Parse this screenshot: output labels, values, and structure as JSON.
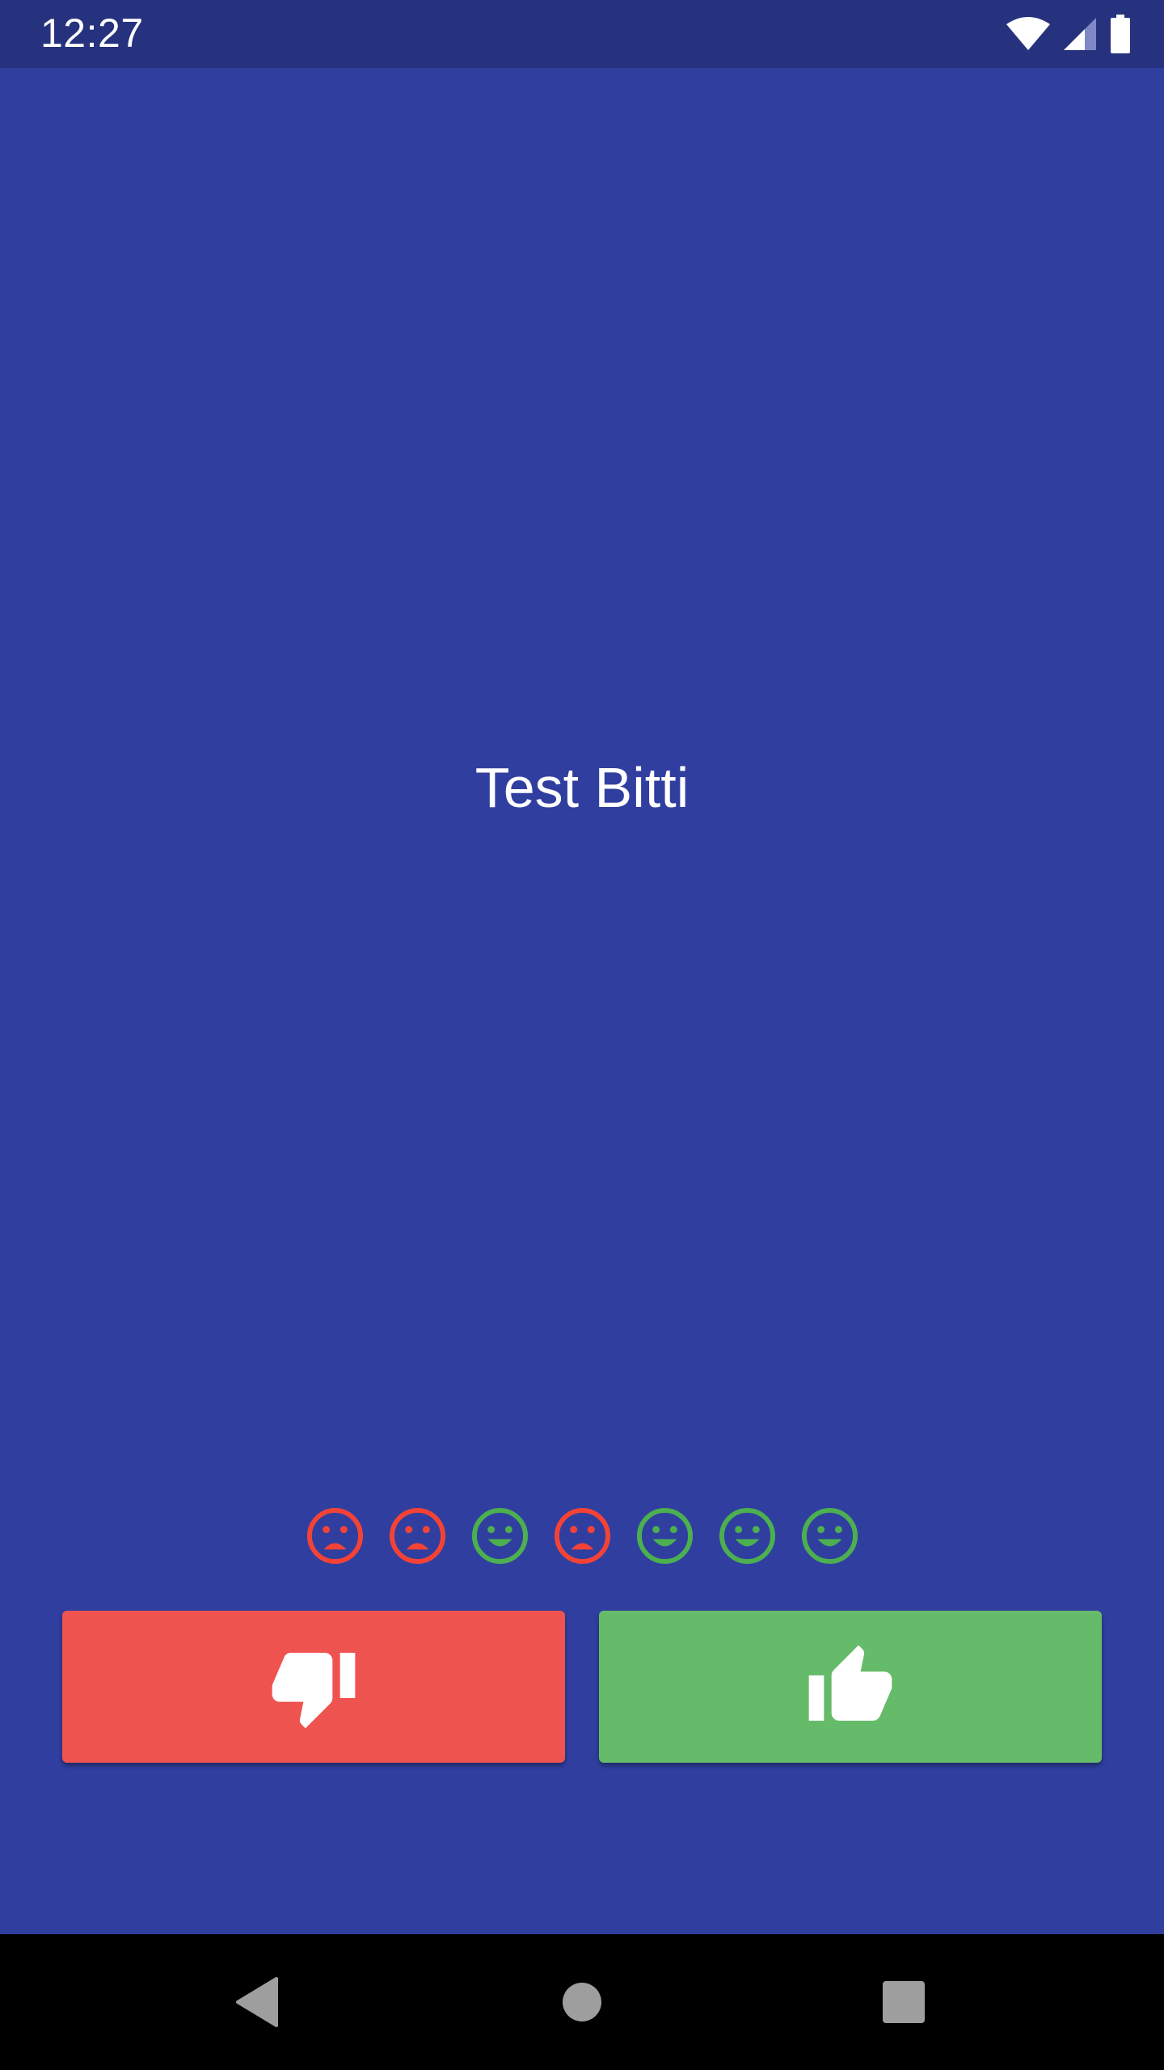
{
  "status_bar": {
    "time": "12:27",
    "icons": [
      "wifi-icon",
      "cell-signal-icon",
      "battery-icon"
    ]
  },
  "main": {
    "result_text": "Test Bitti",
    "answer_history": [
      {
        "result": "wrong",
        "icon": "sad-face-icon"
      },
      {
        "result": "wrong",
        "icon": "sad-face-icon"
      },
      {
        "result": "right",
        "icon": "happy-face-icon"
      },
      {
        "result": "wrong",
        "icon": "sad-face-icon"
      },
      {
        "result": "right",
        "icon": "happy-face-icon"
      },
      {
        "result": "right",
        "icon": "happy-face-icon"
      },
      {
        "result": "right",
        "icon": "happy-face-icon"
      }
    ]
  },
  "buttons": {
    "dislike_icon": "thumbs-down-icon",
    "like_icon": "thumbs-up-icon"
  },
  "nav_bar": {
    "icons": [
      "back-icon",
      "home-icon",
      "recents-icon"
    ]
  },
  "colors": {
    "background": "#303f9f",
    "status_bar": "#26327e",
    "wrong": "#ef5350",
    "right": "#66bb6a",
    "history_wrong": "#f44336",
    "history_right": "#4caf50",
    "nav_bar": "#000000"
  }
}
